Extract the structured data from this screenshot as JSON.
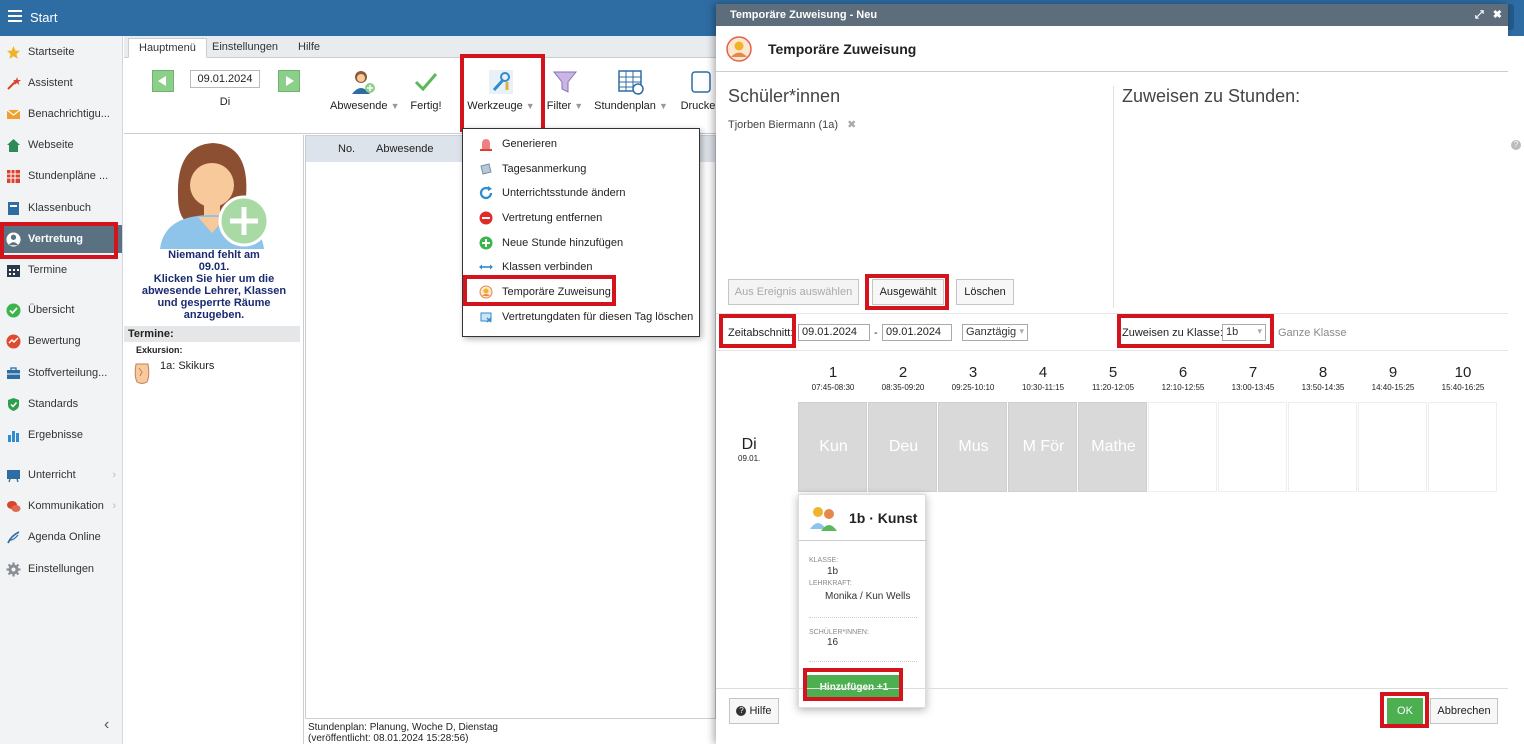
{
  "app": {
    "title": "Start"
  },
  "sidebar": {
    "items": [
      {
        "label": "Startseite",
        "icon": "star-icon"
      },
      {
        "label": "Assistent",
        "icon": "wand-icon"
      },
      {
        "label": "Benachrichtigu...",
        "icon": "envelope-icon"
      },
      {
        "label": "Webseite",
        "icon": "home-icon"
      },
      {
        "label": "Stundenpläne ...",
        "icon": "timetable-icon"
      },
      {
        "label": "Klassenbuch",
        "icon": "book-icon"
      },
      {
        "label": "Vertretung",
        "icon": "person-icon"
      },
      {
        "label": "Termine",
        "icon": "calendar-icon"
      },
      {
        "label": "Übersicht",
        "icon": "check-circle-icon"
      },
      {
        "label": "Bewertung",
        "icon": "rating-icon"
      },
      {
        "label": "Stoffverteilung...",
        "icon": "briefcase-icon"
      },
      {
        "label": "Standards",
        "icon": "shield-icon"
      },
      {
        "label": "Ergebnisse",
        "icon": "bar-chart-icon"
      },
      {
        "label": "Unterricht",
        "icon": "board-icon"
      },
      {
        "label": "Kommunikation",
        "icon": "chat-icon"
      },
      {
        "label": "Agenda Online",
        "icon": "pen-icon"
      },
      {
        "label": "Einstellungen",
        "icon": "gear-icon"
      }
    ]
  },
  "tabs": [
    "Hauptmenü",
    "Einstellungen",
    "Hilfe"
  ],
  "ribbon": {
    "date": "09.01.2024",
    "day": "Di",
    "buttons": {
      "abwesende": "Abwesende",
      "fertig": "Fertig!",
      "werkzeuge": "Werkzeuge",
      "filter": "Filter",
      "stundenplan": "Stundenplan",
      "drucken": "Drucke"
    }
  },
  "left_panel": {
    "absent_message": [
      "Niemand fehlt am",
      "09.01.",
      "Klicken Sie hier um die",
      "abwesende Lehrer, Klassen",
      "und gesperrte Räume",
      "anzugeben."
    ],
    "termine_header": "Termine:",
    "exkursion_label": "Exkursion:",
    "exkursion_item": "1a: Skikurs"
  },
  "content": {
    "col_no": "No.",
    "col_abwesende": "Abwesende"
  },
  "footer_info": {
    "line1": "Stundenplan: Planung, Woche D, Dienstag",
    "line2": "(veröffentlicht: 08.01.2024 15:28:56)"
  },
  "dropdown": {
    "items": [
      {
        "label": "Generieren",
        "icon": "siren-icon"
      },
      {
        "label": "Tagesanmerkung",
        "icon": "note-icon"
      },
      {
        "label": "Unterrichtsstunde ändern",
        "icon": "refresh-icon"
      },
      {
        "label": "Vertretung entfernen",
        "icon": "minus-circle-icon"
      },
      {
        "label": "Neue Stunde hinzufügen",
        "icon": "plus-circle-icon"
      },
      {
        "label": "Klassen verbinden",
        "icon": "double-arrow-icon"
      },
      {
        "label": "Temporäre Zuweisung",
        "icon": "temp-assign-icon"
      },
      {
        "label": "Vertretungdaten für diesen Tag löschen",
        "icon": "erase-icon"
      }
    ]
  },
  "modal": {
    "window_title": "Temporäre Zuweisung - Neu",
    "header_title": "Temporäre Zuweisung",
    "students_title": "Schüler*innen",
    "assign_title": "Zuweisen zu Stunden:",
    "student_tag": "Tjorben Biermann (1a)",
    "btn_event": "Aus Ereignis auswählen",
    "btn_selected": "Ausgewählt",
    "btn_delete": "Löschen",
    "zeitabschnitt_label": "Zeitabschnitt:",
    "date_from": "09.01.2024",
    "dash": "-",
    "date_to": "09.01.2024",
    "ganztaegig": "Ganztägig",
    "assign_class_label": "Zuweisen zu Klasse:",
    "assign_class_value": "1b",
    "whole_class": "Ganze Klasse",
    "day": {
      "name": "Di",
      "date": "09.01."
    },
    "periods": [
      {
        "n": "1",
        "time": "07:45-08:30",
        "subject": "Kun"
      },
      {
        "n": "2",
        "time": "08:35-09:20",
        "subject": "Deu"
      },
      {
        "n": "3",
        "time": "09:25-10:10",
        "subject": "Mus"
      },
      {
        "n": "4",
        "time": "10:30-11:15",
        "subject": "M För"
      },
      {
        "n": "5",
        "time": "11:20-12:05",
        "subject": "Mathe"
      },
      {
        "n": "6",
        "time": "12:10-12:55",
        "subject": ""
      },
      {
        "n": "7",
        "time": "13:00-13:45",
        "subject": ""
      },
      {
        "n": "8",
        "time": "13:50-14:35",
        "subject": ""
      },
      {
        "n": "9",
        "time": "14:40-15:25",
        "subject": ""
      },
      {
        "n": "10",
        "time": "15:40-16:25",
        "subject": ""
      }
    ],
    "popup": {
      "title": "1b · Kunst",
      "klasse_label": "KLASSE:",
      "klasse_value": "1b",
      "lehrkraft_label": "LEHRKRAFT:",
      "lehrkraft_value": "Monika / Kun Wells",
      "schueler_label": "SCHÜLER*INNEN:",
      "schueler_value": "16",
      "add_button": "Hinzufügen +1"
    },
    "btn_help": "Hilfe",
    "btn_ok": "OK",
    "btn_cancel": "Abbrechen"
  },
  "colors": {
    "topbar": "#2e6da4",
    "highlight": "#d4141c",
    "accent_green": "#4caf50",
    "active_sidebar": "#5a7182"
  }
}
